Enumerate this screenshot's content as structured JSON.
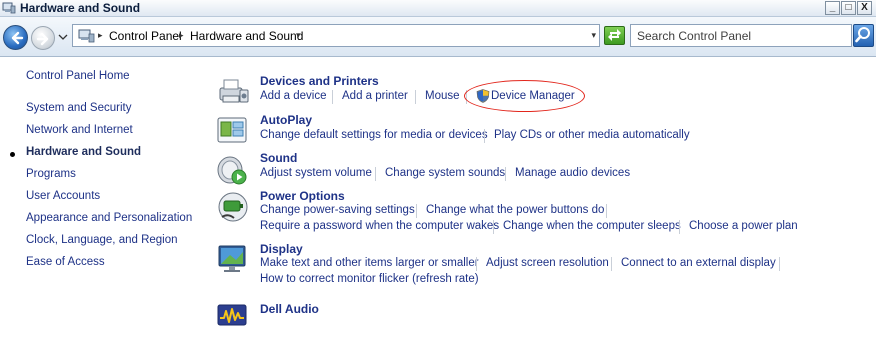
{
  "window": {
    "title": "Hardware and Sound",
    "min_label": "_",
    "max_label": "□",
    "close_label": "X"
  },
  "nav": {
    "breadcrumbs": [
      "Control Panel",
      "Hardware and Sound"
    ],
    "search_placeholder": "Search Control Panel"
  },
  "sidebar": {
    "home": "Control Panel Home",
    "items": [
      {
        "label": "System and Security"
      },
      {
        "label": "Network and Internet"
      },
      {
        "label": "Hardware and Sound",
        "current": true
      },
      {
        "label": "Programs"
      },
      {
        "label": "User Accounts"
      },
      {
        "label": "Appearance and Personalization"
      },
      {
        "label": "Clock, Language, and Region"
      },
      {
        "label": "Ease of Access"
      }
    ]
  },
  "categories": {
    "devices": {
      "title": "Devices and Printers",
      "tasks": [
        "Add a device",
        "Add a printer",
        "Mouse",
        "Device Manager"
      ]
    },
    "autoplay": {
      "title": "AutoPlay",
      "tasks": [
        "Change default settings for media or devices",
        "Play CDs or other media automatically"
      ]
    },
    "sound": {
      "title": "Sound",
      "tasks": [
        "Adjust system volume",
        "Change system sounds",
        "Manage audio devices"
      ]
    },
    "power": {
      "title": "Power Options",
      "tasks": [
        "Change power-saving settings",
        "Change what the power buttons do",
        "Require a password when the computer wakes",
        "Change when the computer sleeps",
        "Choose a power plan"
      ]
    },
    "display": {
      "title": "Display",
      "tasks": [
        "Make text and other items larger or smaller",
        "Adjust screen resolution",
        "Connect to an external display",
        "How to correct monitor flicker (refresh rate)"
      ]
    },
    "audio": {
      "title": "Dell Audio"
    }
  },
  "colors": {
    "link": "#1e3287",
    "highlight_ring": "#e2261c"
  },
  "icons": {
    "devices": "devices-printers-icon",
    "autoplay": "autoplay-icon",
    "sound": "speaker-icon",
    "power": "power-options-icon",
    "display": "display-monitor-icon",
    "audio": "dell-audio-icon",
    "uac": "uac-shield-icon"
  }
}
